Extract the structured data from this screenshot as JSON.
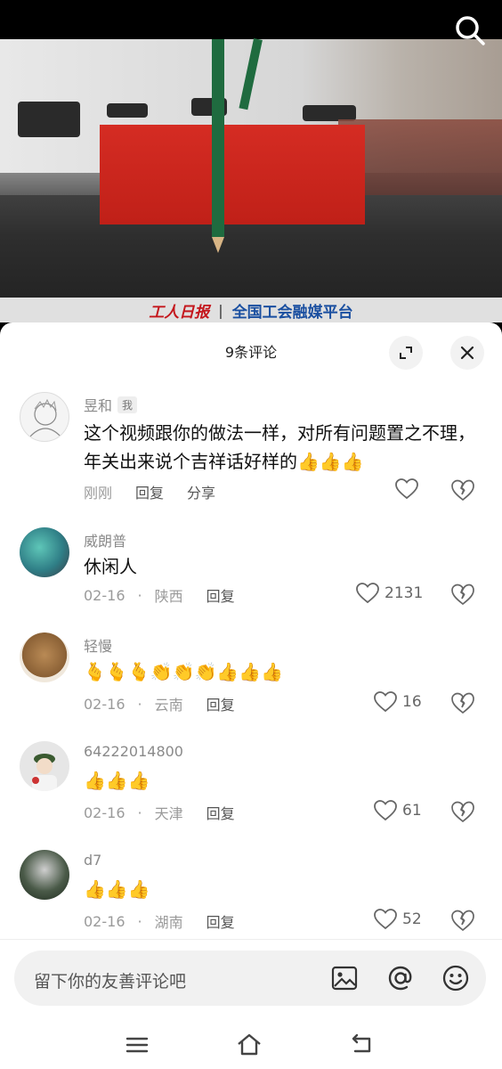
{
  "video": {
    "banner_logo": "工人日报",
    "banner_separator": "|",
    "banner_text": "全国工会融媒平台",
    "search_icon": "search-icon"
  },
  "sheet": {
    "title": "9条评论",
    "expand_icon": "expand-icon",
    "close_icon": "close-icon"
  },
  "comments": [
    {
      "username": "昱和",
      "tag": "我",
      "text": "这个视频跟你的做法一样，对所有问题置之不理，年关出来说个吉祥话好样的",
      "emojis": "👍👍👍",
      "time": "刚刚",
      "reply_label": "回复",
      "share_label": "分享",
      "likes": ""
    },
    {
      "username": "威朗普",
      "text": "休闲人",
      "emojis": "",
      "date": "02-16",
      "location": "陕西",
      "reply_label": "回复",
      "likes": "2131"
    },
    {
      "username": "轻慢",
      "text": "",
      "emojis": "🫰🫰🫰👏👏👏👍👍👍",
      "date": "02-16",
      "location": "云南",
      "reply_label": "回复",
      "likes": "16"
    },
    {
      "username": "64222014800",
      "text": "",
      "emojis": "👍👍👍",
      "date": "02-16",
      "location": "天津",
      "reply_label": "回复",
      "likes": "61"
    },
    {
      "username": "d7",
      "text": "",
      "emojis": "👍👍👍",
      "date": "02-16",
      "location": "湖南",
      "reply_label": "回复",
      "likes": "52"
    }
  ],
  "input": {
    "placeholder": "留下你的友善评论吧",
    "image_icon": "image-icon",
    "at_icon": "at-icon",
    "emoji_icon": "smiley-icon"
  },
  "nav": {
    "menu_icon": "menu-icon",
    "home_icon": "home-icon",
    "back_icon": "back-icon"
  },
  "colors": {
    "accent_red": "#c4161c",
    "accent_blue": "#1a4fa0"
  }
}
